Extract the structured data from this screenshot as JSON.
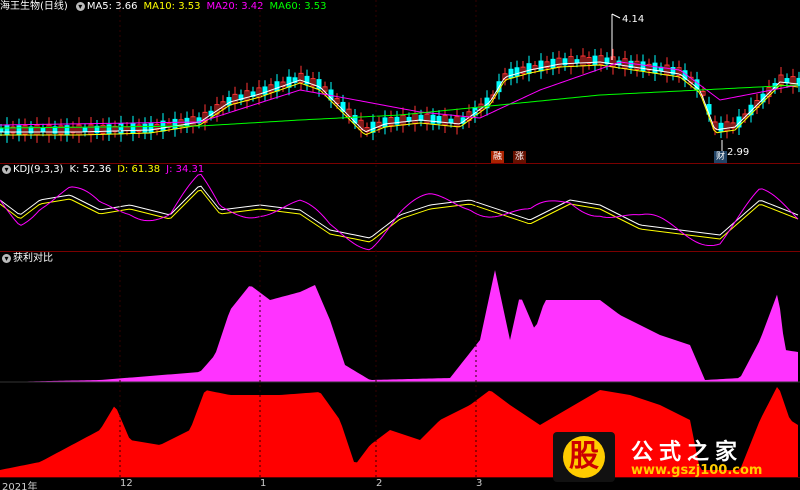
{
  "header": {
    "stock_name": "海王生物(日线)",
    "ma": [
      {
        "label": "MA5:",
        "value": "3.66",
        "color": "#ffffff"
      },
      {
        "label": "MA10:",
        "value": "3.53",
        "color": "#ffff00"
      },
      {
        "label": "MA20:",
        "value": "3.42",
        "color": "#ff00ff"
      },
      {
        "label": "MA60:",
        "value": "3.53",
        "color": "#00ff00"
      }
    ]
  },
  "kdj": {
    "title": "KDJ(9,3,3)",
    "k_label": "K:",
    "k_value": "52.36",
    "d_label": "D:",
    "d_value": "61.38",
    "j_label": "J:",
    "j_value": "34.31",
    "k_color": "#ffffff",
    "d_color": "#ffff00",
    "j_color": "#ff00ff"
  },
  "profit": {
    "title": "获利对比",
    "top_color": "#ff33ff",
    "bottom_color": "#ff0000"
  },
  "annotations": {
    "high_price": "4.14",
    "low_price": "2.99",
    "tag_1": "融",
    "tag_2": "涨",
    "tag_3": "财"
  },
  "time_axis": [
    "2021年",
    "12",
    "1",
    "2",
    "3"
  ],
  "watermark": {
    "glyph": "股",
    "text": "公式之家",
    "url": "www.gszj100.com"
  },
  "chart_data": {
    "type": "candlestick",
    "price_range": [
      2.99,
      4.14
    ],
    "ma_values": {
      "MA5": 3.66,
      "MA10": 3.53,
      "MA20": 3.42,
      "MA60": 3.53
    },
    "kdj_values": {
      "K": 52.36,
      "D": 61.38,
      "J": 34.31
    }
  }
}
